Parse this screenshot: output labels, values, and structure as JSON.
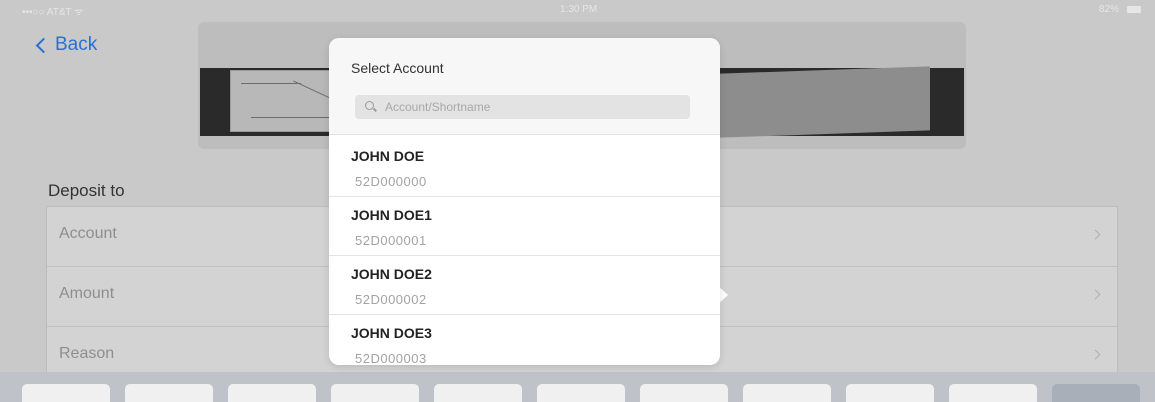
{
  "status_bar": {
    "carrier": "•••○○ AT&T ᯤ",
    "time": "1:30 PM",
    "battery": "82%"
  },
  "nav": {
    "back_label": "Back"
  },
  "form": {
    "section_title": "Deposit to",
    "rows": [
      {
        "label": "Account"
      },
      {
        "label": "Amount"
      },
      {
        "label": "Reason"
      }
    ]
  },
  "popover": {
    "title": "Select Account",
    "search_placeholder": "Account/Shortname",
    "search_value": "",
    "accounts": [
      {
        "name": "JOHN DOE",
        "number": "52D000000"
      },
      {
        "name": "JOHN DOE1",
        "number": "52D000001"
      },
      {
        "name": "JOHN DOE2",
        "number": "52D000002"
      },
      {
        "name": "JOHN DOE3",
        "number": "52D000003"
      }
    ]
  },
  "icons": {
    "back": "chevron-left-icon",
    "search": "search-icon",
    "row_disclosure": "chevron-right-icon"
  },
  "colors": {
    "accent": "#2a6fd8",
    "popover_bg": "#ffffff",
    "dim_background": "#c9c9c9"
  }
}
